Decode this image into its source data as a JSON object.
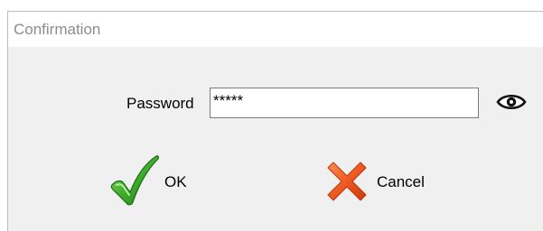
{
  "window": {
    "title": "Confirmation"
  },
  "form": {
    "password_label": "Password",
    "password_value": "*****",
    "reveal_icon": "eye-icon"
  },
  "buttons": {
    "ok_label": "OK",
    "ok_icon": "checkmark-icon",
    "cancel_label": "Cancel",
    "cancel_icon": "x-icon"
  },
  "colors": {
    "title_text": "#8c8c8c",
    "dialog_bg": "#f0f0f0",
    "check_green": "#3fae2a",
    "cancel_orange": "#f05a22"
  }
}
